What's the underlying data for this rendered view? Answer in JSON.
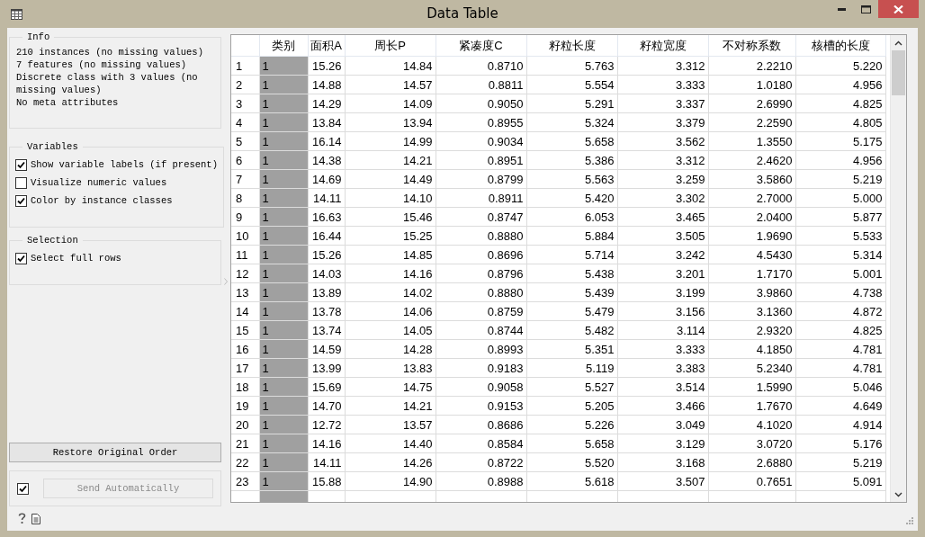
{
  "window": {
    "title": "Data Table"
  },
  "info": {
    "title": "Info",
    "lines": [
      "210 instances (no missing values)",
      "7 features (no missing values)",
      "Discrete class with 3 values (no missing values)",
      "No meta attributes"
    ]
  },
  "variables": {
    "title": "Variables",
    "options": [
      {
        "label": "Show variable labels (if present)",
        "checked": true
      },
      {
        "label": "Visualize numeric values",
        "checked": false
      },
      {
        "label": "Color by instance classes",
        "checked": true
      }
    ]
  },
  "selection": {
    "title": "Selection",
    "options": [
      {
        "label": "Select full rows",
        "checked": true
      }
    ]
  },
  "restore_button": "Restore Original Order",
  "auto_send": {
    "checked": true,
    "label": "Send Automatically",
    "disabled": true
  },
  "table": {
    "columns": [
      {
        "label": "类别",
        "kind": "class"
      },
      {
        "label": "面积A",
        "kind": "numeric"
      },
      {
        "label": "周长P",
        "kind": "numeric"
      },
      {
        "label": "紧凑度C",
        "kind": "numeric"
      },
      {
        "label": "籽粒长度",
        "kind": "numeric"
      },
      {
        "label": "籽粒宽度",
        "kind": "numeric"
      },
      {
        "label": "不对称系数",
        "kind": "numeric"
      },
      {
        "label": "核槽的长度",
        "kind": "numeric"
      }
    ],
    "rows": [
      {
        "header": "1",
        "cells": [
          "1",
          "15.26",
          "14.84",
          "0.8710",
          "5.763",
          "3.312",
          "2.2210",
          "5.220"
        ]
      },
      {
        "header": "2",
        "cells": [
          "1",
          "14.88",
          "14.57",
          "0.8811",
          "5.554",
          "3.333",
          "1.0180",
          "4.956"
        ]
      },
      {
        "header": "3",
        "cells": [
          "1",
          "14.29",
          "14.09",
          "0.9050",
          "5.291",
          "3.337",
          "2.6990",
          "4.825"
        ]
      },
      {
        "header": "4",
        "cells": [
          "1",
          "13.84",
          "13.94",
          "0.8955",
          "5.324",
          "3.379",
          "2.2590",
          "4.805"
        ]
      },
      {
        "header": "5",
        "cells": [
          "1",
          "16.14",
          "14.99",
          "0.9034",
          "5.658",
          "3.562",
          "1.3550",
          "5.175"
        ]
      },
      {
        "header": "6",
        "cells": [
          "1",
          "14.38",
          "14.21",
          "0.8951",
          "5.386",
          "3.312",
          "2.4620",
          "4.956"
        ]
      },
      {
        "header": "7",
        "cells": [
          "1",
          "14.69",
          "14.49",
          "0.8799",
          "5.563",
          "3.259",
          "3.5860",
          "5.219"
        ]
      },
      {
        "header": "8",
        "cells": [
          "1",
          "14.11",
          "14.10",
          "0.8911",
          "5.420",
          "3.302",
          "2.7000",
          "5.000"
        ]
      },
      {
        "header": "9",
        "cells": [
          "1",
          "16.63",
          "15.46",
          "0.8747",
          "6.053",
          "3.465",
          "2.0400",
          "5.877"
        ]
      },
      {
        "header": "10",
        "cells": [
          "1",
          "16.44",
          "15.25",
          "0.8880",
          "5.884",
          "3.505",
          "1.9690",
          "5.533"
        ]
      },
      {
        "header": "11",
        "cells": [
          "1",
          "15.26",
          "14.85",
          "0.8696",
          "5.714",
          "3.242",
          "4.5430",
          "5.314"
        ]
      },
      {
        "header": "12",
        "cells": [
          "1",
          "14.03",
          "14.16",
          "0.8796",
          "5.438",
          "3.201",
          "1.7170",
          "5.001"
        ]
      },
      {
        "header": "13",
        "cells": [
          "1",
          "13.89",
          "14.02",
          "0.8880",
          "5.439",
          "3.199",
          "3.9860",
          "4.738"
        ]
      },
      {
        "header": "14",
        "cells": [
          "1",
          "13.78",
          "14.06",
          "0.8759",
          "5.479",
          "3.156",
          "3.1360",
          "4.872"
        ]
      },
      {
        "header": "15",
        "cells": [
          "1",
          "13.74",
          "14.05",
          "0.8744",
          "5.482",
          "3.114",
          "2.9320",
          "4.825"
        ]
      },
      {
        "header": "16",
        "cells": [
          "1",
          "14.59",
          "14.28",
          "0.8993",
          "5.351",
          "3.333",
          "4.1850",
          "4.781"
        ]
      },
      {
        "header": "17",
        "cells": [
          "1",
          "13.99",
          "13.83",
          "0.9183",
          "5.119",
          "3.383",
          "5.2340",
          "4.781"
        ]
      },
      {
        "header": "18",
        "cells": [
          "1",
          "15.69",
          "14.75",
          "0.9058",
          "5.527",
          "3.514",
          "1.5990",
          "5.046"
        ]
      },
      {
        "header": "19",
        "cells": [
          "1",
          "14.70",
          "14.21",
          "0.9153",
          "5.205",
          "3.466",
          "1.7670",
          "4.649"
        ]
      },
      {
        "header": "20",
        "cells": [
          "1",
          "12.72",
          "13.57",
          "0.8686",
          "5.226",
          "3.049",
          "4.1020",
          "4.914"
        ]
      },
      {
        "header": "21",
        "cells": [
          "1",
          "14.16",
          "14.40",
          "0.8584",
          "5.658",
          "3.129",
          "3.0720",
          "5.176"
        ]
      },
      {
        "header": "22",
        "cells": [
          "1",
          "14.11",
          "14.26",
          "0.8722",
          "5.520",
          "3.168",
          "2.6880",
          "5.219"
        ]
      },
      {
        "header": "23",
        "cells": [
          "1",
          "15.88",
          "14.90",
          "0.8988",
          "5.618",
          "3.507",
          "0.7651",
          "5.091"
        ]
      }
    ]
  }
}
